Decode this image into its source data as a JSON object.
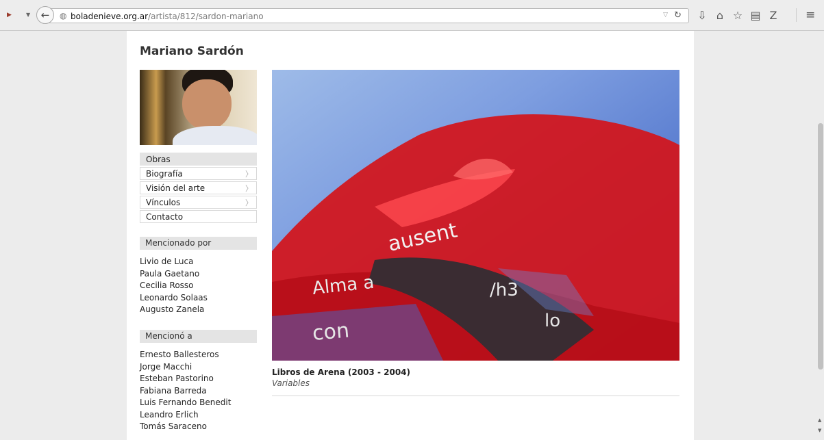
{
  "browser": {
    "url_host": "boladenieve.org.ar",
    "url_path": "/artista/812/sardon-mariano"
  },
  "artist": {
    "name": "Mariano Sardón"
  },
  "nav": {
    "items": [
      {
        "label": "Obras"
      },
      {
        "label": "Biografía"
      },
      {
        "label": "Visión del arte"
      },
      {
        "label": "Vínculos"
      },
      {
        "label": "Contacto"
      }
    ]
  },
  "mentioned_by": {
    "title": "Mencionado por",
    "people": [
      "Livio de Luca",
      "Paula Gaetano",
      "Cecilia Rosso",
      "Leonardo Solaas",
      "Augusto Zanela"
    ]
  },
  "mentioned": {
    "title": "Mencionó a",
    "people": [
      "Ernesto Ballesteros",
      "Jorge Macchi",
      "Esteban Pastorino",
      "Fabiana Barreda",
      "Luis Fernando Benedit",
      "Leandro Erlich",
      "Tomás Saraceno"
    ]
  },
  "artwork": {
    "title": "Libros de Arena (2003 - 2004)",
    "subtitle": "Variables",
    "overlay_text": [
      "ausent",
      "Alma a",
      "/h3",
      "con",
      "lo"
    ]
  }
}
